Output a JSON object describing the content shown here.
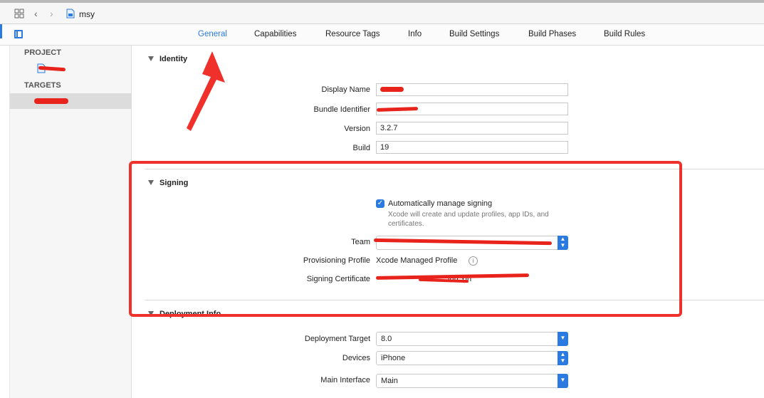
{
  "navbar": {
    "breadcrumb": "msy",
    "icons": [
      "grid-icon",
      "chevron-left-icon",
      "chevron-right-icon",
      "file-icon"
    ]
  },
  "tabs": [
    {
      "label": "General",
      "active": true
    },
    {
      "label": "Capabilities",
      "active": false
    },
    {
      "label": "Resource Tags",
      "active": false
    },
    {
      "label": "Info",
      "active": false
    },
    {
      "label": "Build Settings",
      "active": false
    },
    {
      "label": "Build Phases",
      "active": false
    },
    {
      "label": "Build Rules",
      "active": false
    }
  ],
  "sidebar": {
    "project_header": "PROJECT",
    "targets_header": "TARGETS"
  },
  "identity": {
    "title": "Identity",
    "display_name_label": "Display Name",
    "bundle_identifier_label": "Bundle Identifier",
    "version_label": "Version",
    "version_value": "3.2.7",
    "build_label": "Build",
    "build_value": "19"
  },
  "signing": {
    "title": "Signing",
    "auto_manage_label": "Automatically manage signing",
    "auto_manage_checked": true,
    "auto_manage_note": "Xcode will create and update profiles, app IDs, and certificates.",
    "team_label": "Team",
    "provisioning_label": "Provisioning Profile",
    "provisioning_value": "Xcode Managed Profile",
    "certificate_label": "Signing Certificate",
    "certificate_value_visible": "Jun Yin"
  },
  "deployment": {
    "title": "Deployment Info",
    "target_label": "Deployment Target",
    "target_value": "8.0",
    "devices_label": "Devices",
    "devices_value": "iPhone",
    "interface_label": "Main Interface",
    "interface_value": "Main"
  },
  "colors": {
    "accent": "#2b7ae0",
    "annotation_red": "#e8231b"
  }
}
